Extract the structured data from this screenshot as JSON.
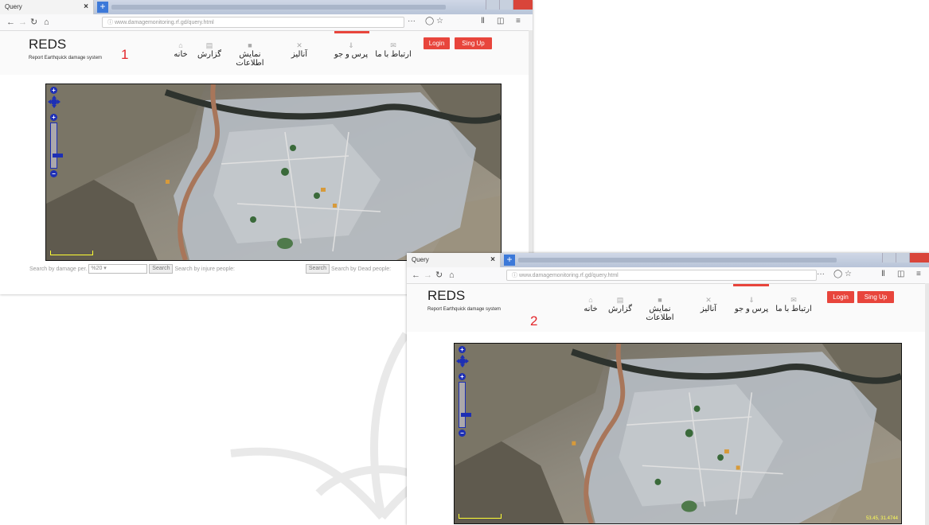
{
  "browser": {
    "tab_title": "Query",
    "tab_close": "×",
    "new_tab": "+",
    "url": "www.damagemonitoring.rf.gd/query.html",
    "url_domain": "rf.gd",
    "menu_dots": "···",
    "icon_names": [
      "back-icon",
      "forward-icon",
      "reload-icon",
      "home-icon",
      "info-icon",
      "pocket-icon",
      "star-icon",
      "library-icon",
      "sidebar-icon",
      "menu-icon"
    ]
  },
  "site": {
    "brand_title": "REDS",
    "brand_subtitle": "Report Earthquick damage system",
    "nav": [
      {
        "label": "خانه",
        "icon": "home-icon"
      },
      {
        "label": "گزارش",
        "icon": "report-icon"
      },
      {
        "label": "نمایش اطلاعات",
        "icon": "info-display-icon"
      },
      {
        "label": "آنالیز",
        "icon": "analysis-icon"
      },
      {
        "label": "پرس و جو",
        "icon": "query-icon"
      },
      {
        "label": "ارتباط با ما",
        "icon": "contact-icon"
      }
    ],
    "active_nav": "پرس و جو",
    "login_label": "Login",
    "signup_label": "Sing Up"
  },
  "screens": [
    {
      "annotation": "1",
      "search": {
        "damage_label": "Search by damage per.",
        "damage_value": "%20",
        "search1": "Search",
        "injured_label": "Search by injure people:",
        "search2": "Search",
        "dead_label": "Search by Dead people:"
      }
    },
    {
      "annotation": "2",
      "coords": "53.45, 31.4744"
    }
  ],
  "map": {
    "controls": [
      "pan-up-icon",
      "pan-left-icon",
      "pan-right-icon",
      "pan-down-icon",
      "zoom-in-icon",
      "zoom-out-icon"
    ],
    "scale_label": "500 m",
    "colors": {
      "terrain_dark": "#3b3e3a",
      "terrain_light": "#a39a88",
      "road": "#a8765a",
      "urban": "#b9c0c8",
      "accent_red": "#e8453c",
      "control_blue": "#1d2fb5"
    }
  }
}
